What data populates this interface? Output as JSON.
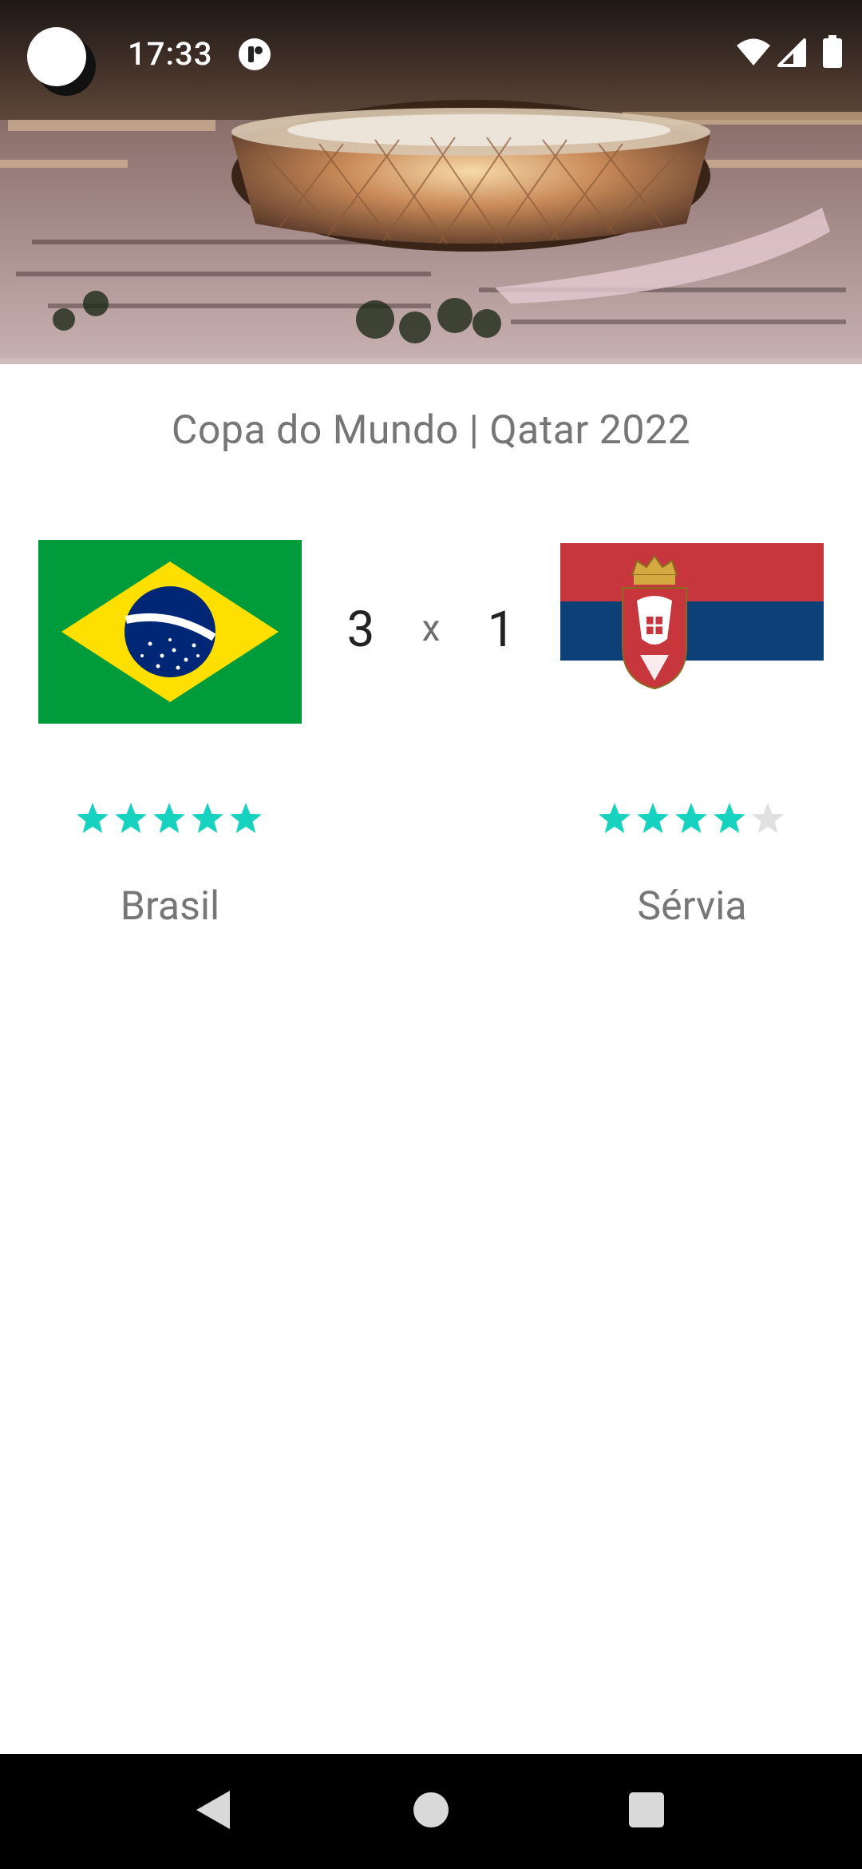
{
  "status_bar": {
    "time": "17:33",
    "icons": [
      "notification-app-icon",
      "wifi-icon",
      "signal-icon",
      "battery-icon"
    ]
  },
  "header": {
    "image": "stadium-photo"
  },
  "match": {
    "title": "Copa do Mundo | Qatar 2022",
    "separator": "x",
    "home": {
      "name": "Brasil",
      "score": "3",
      "rating": 5,
      "rating_max": 5,
      "flag": "brazil-flag"
    },
    "away": {
      "name": "Sérvia",
      "score": "1",
      "rating": 4,
      "rating_max": 5,
      "flag": "serbia-flag"
    }
  },
  "colors": {
    "star_filled": "#18d2c0",
    "star_empty": "#e0e0e0",
    "title_text": "#767676",
    "score_text": "#222222"
  },
  "nav_bar": {
    "buttons": [
      "back",
      "home",
      "recents"
    ]
  }
}
